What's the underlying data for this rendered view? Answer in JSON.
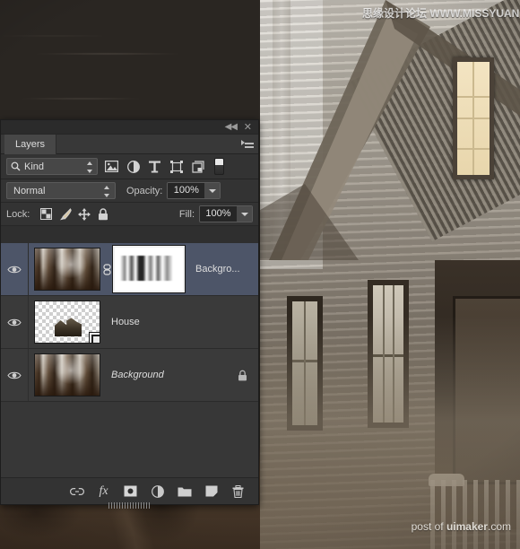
{
  "watermarks": {
    "top": "思缘设计论坛 WWW.MISSYUAN.COM",
    "bottom_prefix": "post of ",
    "bottom_brand": "uimaker",
    "bottom_suffix": ".com"
  },
  "panel": {
    "tab_label": "Layers",
    "collapse_icon": "double-left-chevron-icon",
    "close_icon": "close-icon",
    "menu_icon": "panel-menu-icon",
    "filter": {
      "search_icon": "search-icon",
      "kind_label": "Kind",
      "icons": [
        {
          "name": "filter-pixel-layers-icon",
          "title": "Pixel layers"
        },
        {
          "name": "filter-adjustment-layers-icon",
          "title": "Adjustment layers"
        },
        {
          "name": "filter-type-layers-icon",
          "title": "Type layers"
        },
        {
          "name": "filter-shape-layers-icon",
          "title": "Shape layers"
        },
        {
          "name": "filter-smart-objects-icon",
          "title": "Smart objects"
        }
      ],
      "toggle_name": "filter-enable-toggle"
    },
    "blend": {
      "mode": "Normal",
      "opacity_label": "Opacity:",
      "opacity_value": "100%"
    },
    "lock": {
      "label": "Lock:",
      "icons": [
        {
          "name": "lock-transparent-pixels-icon"
        },
        {
          "name": "lock-image-pixels-icon"
        },
        {
          "name": "lock-position-icon"
        },
        {
          "name": "lock-all-icon"
        }
      ],
      "fill_label": "Fill:",
      "fill_value": "100%"
    },
    "layers": [
      {
        "name": "Backgro...",
        "selected": true,
        "visible": true,
        "has_mask": true,
        "linked": true,
        "locked": false,
        "italic": false,
        "thumb": "forest"
      },
      {
        "name": "House",
        "selected": false,
        "visible": true,
        "has_mask": false,
        "linked": false,
        "locked": false,
        "italic": false,
        "thumb": "transparent-house"
      },
      {
        "name": "Background",
        "selected": false,
        "visible": true,
        "has_mask": false,
        "linked": false,
        "locked": true,
        "italic": true,
        "thumb": "forest"
      }
    ],
    "footer_icons": [
      {
        "name": "link-layers-icon"
      },
      {
        "name": "layer-style-fx-icon"
      },
      {
        "name": "add-layer-mask-icon"
      },
      {
        "name": "new-adjustment-layer-icon"
      },
      {
        "name": "new-group-icon"
      },
      {
        "name": "new-layer-icon"
      },
      {
        "name": "delete-layer-icon"
      }
    ]
  },
  "colors": {
    "panel_bg": "#2f2f2f",
    "row_bg": "#3a3a3a",
    "row_selected": "#4d5568",
    "text": "#dedede",
    "lit_window": "#f0e0bc"
  }
}
